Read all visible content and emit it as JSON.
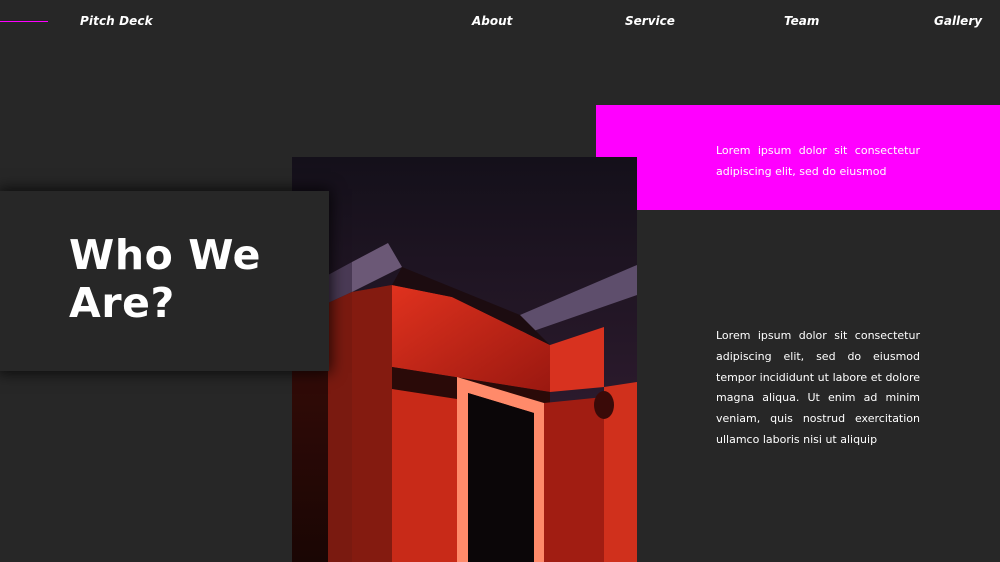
{
  "header": {
    "brand": "Pitch Deck",
    "nav": [
      "About",
      "Service",
      "Team",
      "Gallery"
    ]
  },
  "hero": {
    "title": "Who We\nAre?",
    "photo_icon": "red-doorway-photo"
  },
  "callout": {
    "text": "Lorem ipsum dolor sit consectetur adipiscing elit, sed do eiusmod"
  },
  "body": {
    "text": "Lorem ipsum dolor sit consectetur adipiscing elit, sed do eiusmod tempor incididunt ut labore et dolore magna aliqua. Ut enim ad minim veniam, quis nostrud exercitation ullamco laboris nisi ut aliquip"
  },
  "colors": {
    "background": "#272727",
    "accent": "#ff00ff",
    "text": "#ffffff"
  }
}
